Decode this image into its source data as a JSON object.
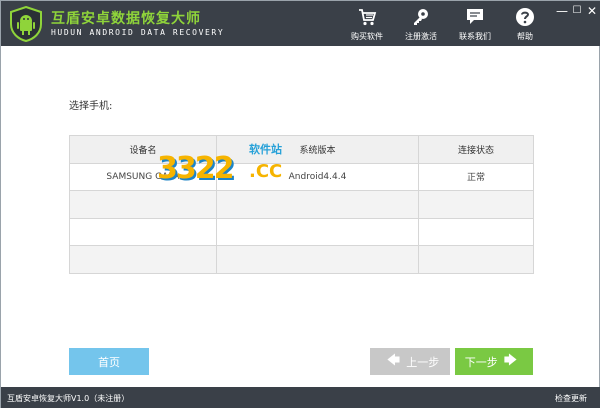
{
  "header": {
    "title_cn": "互盾安卓数据恢复大师",
    "title_en": "HUDUN ANDROID DATA RECOVERY",
    "nav": [
      {
        "label": "购买软件",
        "icon": "cart-icon"
      },
      {
        "label": "注册激活",
        "icon": "key-icon"
      },
      {
        "label": "联系我们",
        "icon": "chat-icon"
      },
      {
        "label": "帮助",
        "icon": "help-icon"
      }
    ],
    "window": {
      "minimize": "—",
      "maximize": "☐",
      "close": "✕"
    }
  },
  "main": {
    "select_label": "选择手机:",
    "table": {
      "headers": [
        "设备名",
        "系统版本",
        "连接状态"
      ],
      "rows": [
        [
          "SAMSUNG GALA",
          "Android4.4.4",
          "正常"
        ],
        [
          "",
          "",
          ""
        ],
        [
          "",
          "",
          ""
        ],
        [
          "",
          "",
          ""
        ]
      ]
    }
  },
  "watermark": {
    "site": "软件站",
    "number": "3322",
    "domain": ".CC"
  },
  "buttons": {
    "home": "首页",
    "prev": "上一步",
    "next": "下一步",
    "prev_arrow": "🡄",
    "next_arrow": "🡆"
  },
  "footer": {
    "version": "互盾安卓恢复大师V1.0（未注册）",
    "update": "检查更新"
  },
  "colors": {
    "header_bg": "#3a4048",
    "title_green": "#8fd43a",
    "home_blue": "#74c5ec",
    "next_green": "#7ac943",
    "prev_gray": "#c8c8c8"
  }
}
